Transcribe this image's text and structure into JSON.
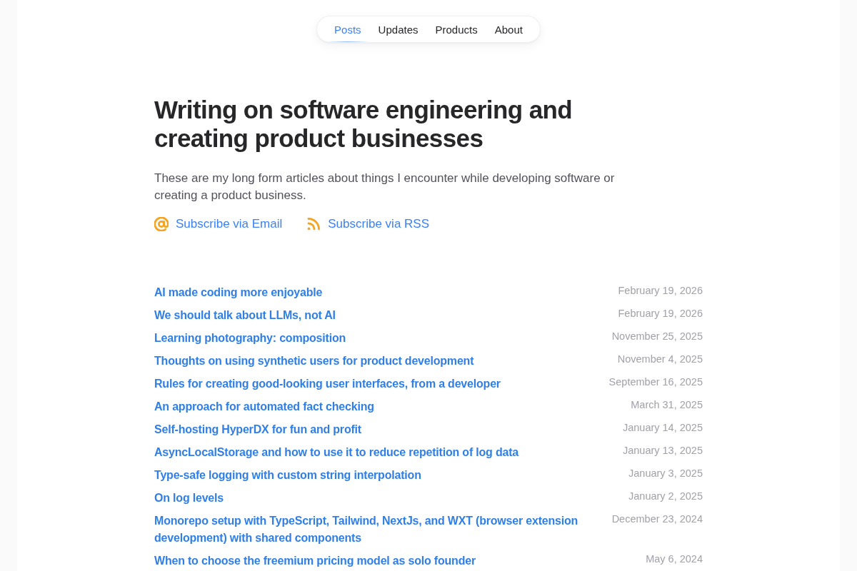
{
  "nav": {
    "items": [
      {
        "label": "Posts",
        "selected": true
      },
      {
        "label": "Updates",
        "selected": false
      },
      {
        "label": "Products",
        "selected": false
      },
      {
        "label": "About",
        "selected": false
      }
    ]
  },
  "intro": {
    "title": "Writing on software engineering and creating product businesses",
    "description": "These are my long form articles about things I encounter while developing software or creating a product business."
  },
  "subscribe": [
    {
      "kind": "email",
      "label": "Subscribe via Email"
    },
    {
      "kind": "rss",
      "label": "Subscribe via RSS"
    }
  ],
  "posts": [
    {
      "title": "AI made coding more enjoyable",
      "date": "February 19, 2026"
    },
    {
      "title": "We should talk about LLMs, not AI",
      "date": "February 19, 2026"
    },
    {
      "title": "Learning photography: composition",
      "date": "November 25, 2025"
    },
    {
      "title": "Thoughts on using synthetic users for product development",
      "date": "November 4, 2025"
    },
    {
      "title": "Rules for creating good-looking user interfaces, from a developer",
      "date": "September 16, 2025"
    },
    {
      "title": "An approach for automated fact checking",
      "date": "March 31, 2025"
    },
    {
      "title": "Self-hosting HyperDX for fun and profit",
      "date": "January 14, 2025"
    },
    {
      "title": "AsyncLocalStorage and how to use it to reduce repetition of log data",
      "date": "January 13, 2025"
    },
    {
      "title": "Type-safe logging with custom string interpolation",
      "date": "January 3, 2025"
    },
    {
      "title": "On log levels",
      "date": "January 2, 2025"
    },
    {
      "title": "Monorepo setup with TypeScript, Tailwind, NextJs, and WXT (browser extension development) with shared components",
      "date": "December 23, 2024"
    },
    {
      "title": "When to choose the freemium pricing model as solo founder",
      "date": "May 6, 2024"
    }
  ]
}
